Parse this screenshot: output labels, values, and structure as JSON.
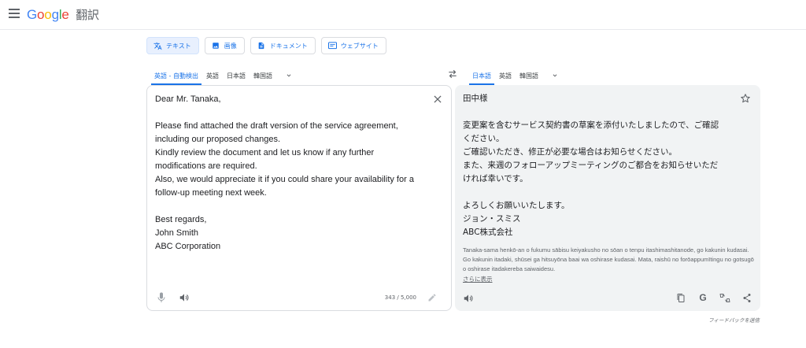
{
  "header": {
    "logo": {
      "G": "G",
      "o1": "o",
      "o2": "o",
      "g": "g",
      "l": "l",
      "e": "e"
    },
    "product": "翻訳"
  },
  "modes": [
    {
      "label": "テキスト",
      "icon": "translate-icon",
      "active": true
    },
    {
      "label": "画像",
      "icon": "image-icon",
      "active": false
    },
    {
      "label": "ドキュメント",
      "icon": "document-icon",
      "active": false
    },
    {
      "label": "ウェブサイト",
      "icon": "website-icon",
      "active": false
    }
  ],
  "source": {
    "languages": [
      "英語 - 自動検出",
      "英語",
      "日本語",
      "韓国語"
    ],
    "text": "Dear Mr. Tanaka,\n\nPlease find attached the draft version of the service agreement,\nincluding our proposed changes.\nKindly review the document and let us know if any further\nmodifications are required.\nAlso, we would appreciate it if you could share your availability for a\nfollow-up meeting next week.\n\nBest regards,\nJohn Smith\nABC Corporation",
    "char_count": "343 / 5,000"
  },
  "target": {
    "languages": [
      "日本語",
      "英語",
      "韓国語"
    ],
    "text": "田中様\n\n変更案を含むサービス契約書の草案を添付いたしましたので、ご確認\nください。\nご確認いただき、修正が必要な場合はお知らせください。\nまた、来週のフォローアップミーティングのご都合をお知らせいただ\nければ幸いです。\n\nよろしくお願いいたします。\nジョン・スミス\nABC株式会社",
    "romanization": "Tanaka-sama henkō-an o fukumu sābisu keiyakusho no sōan o tenpu itashimashitanode, go kakunin kudasai. Go kakunin itadaki, shūsei ga hitsuyōna baai wa oshirase kudasai. Mata, raishū no forōappumītingu no gotsugō o oshirase itadakereba saiwaidesu.",
    "more_label": "さらに表示"
  },
  "feedback": "フィードバックを送信"
}
